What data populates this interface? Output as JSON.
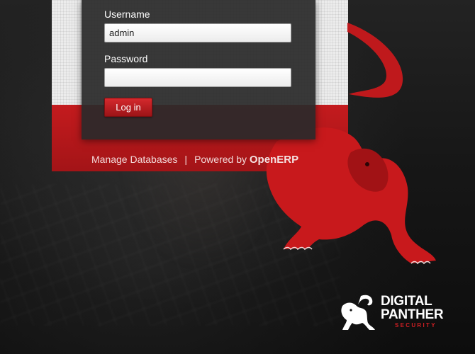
{
  "login": {
    "username_label": "Username",
    "username_value": "admin",
    "password_label": "Password",
    "password_value": "",
    "login_button": "Log in"
  },
  "footer": {
    "manage_databases": "Manage Databases",
    "separator": "|",
    "powered_by": "Powered by",
    "openerp": "OpenERP"
  },
  "logo": {
    "line1": "DIGITAL",
    "line2": "PANTHER",
    "line3": "SECURITY"
  },
  "colors": {
    "accent_red": "#c41b1e",
    "panel_dark": "#2a2a2a"
  }
}
